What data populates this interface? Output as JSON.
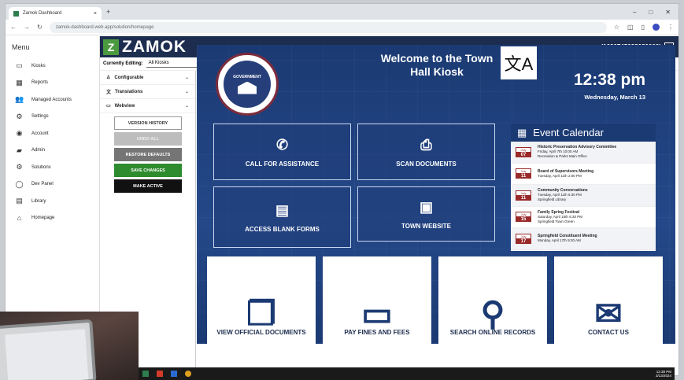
{
  "browser": {
    "tab_title": "Zamok Dashboard",
    "tab_close": "×",
    "new_tab": "+",
    "url": "zamok-dashboard.web.app/solution/homepage",
    "window_controls": [
      "–",
      "□",
      "✕"
    ]
  },
  "menu": {
    "title": "Menu",
    "items": [
      {
        "label": "Kiosks",
        "icon": "monitor-icon",
        "glyph": "▭"
      },
      {
        "label": "Reports",
        "icon": "reports-icon",
        "glyph": "▦"
      },
      {
        "label": "Managed Accounts",
        "icon": "users-icon",
        "glyph": "👥"
      },
      {
        "label": "Settings",
        "icon": "gear-icon",
        "glyph": "⚙"
      },
      {
        "label": "Account",
        "icon": "account-icon",
        "glyph": "◉"
      },
      {
        "label": "Admin",
        "icon": "briefcase-icon",
        "glyph": "▰"
      },
      {
        "label": "Solutions",
        "icon": "solutions-icon",
        "glyph": "⚙"
      },
      {
        "label": "Dev Panel",
        "icon": "dev-panel-icon",
        "glyph": "◯"
      },
      {
        "label": "Library",
        "icon": "library-icon",
        "glyph": "▤"
      },
      {
        "label": "Homepage",
        "icon": "home-icon",
        "glyph": "⌂"
      }
    ]
  },
  "header": {
    "logo_mark": "Z",
    "logo_text": "ZAMOK",
    "device_id": "(1620745088080000)",
    "exit_glyph": "→"
  },
  "editing": {
    "label": "Currently Editing:",
    "value": "All Kiosks",
    "chevron": "⌄"
  },
  "config": {
    "sections": [
      {
        "label": "Configurable",
        "icon": "configurable-icon",
        "glyph": "♙"
      },
      {
        "label": "Translations",
        "icon": "translate-icon",
        "glyph": "文"
      },
      {
        "label": "Webview",
        "icon": "webview-icon",
        "glyph": "▭"
      }
    ],
    "chevron": "⌄",
    "buttons": {
      "version_history": "VERSION HISTORY",
      "undo_all": "UNDO ALL",
      "restore_defaults": "RESTORE DEFAULTS",
      "save_changes": "SAVE CHANGES",
      "make_active": "MAKE ACTIVE"
    }
  },
  "kiosk": {
    "seal_text": "GOVERNMENT",
    "welcome": "Welcome to the Town Hall Kiosk",
    "lang_glyph": "文A",
    "time": "12:38 pm",
    "date": "Wednesday, March 13",
    "tiles_small": [
      {
        "label": "CALL FOR ASSISTANCE",
        "icon": "phone-icon",
        "glyph": "✆"
      },
      {
        "label": "SCAN DOCUMENTS",
        "icon": "scanner-icon",
        "glyph": "⎙"
      },
      {
        "label": "ACCESS BLANK FORMS",
        "icon": "forms-icon",
        "glyph": "▤"
      },
      {
        "label": "TOWN WEBSITE",
        "icon": "website-icon",
        "glyph": "▣"
      }
    ],
    "calendar": {
      "title": "Event Calendar",
      "icon_glyph": "▦",
      "events": [
        {
          "month": "July",
          "day": "07",
          "title": "Historic Preservation Advisory Committee",
          "time": "Friday, April 7th 10:00 AM",
          "place": "Recreation & Parks Main Office"
        },
        {
          "month": "July",
          "day": "11",
          "title": "Board of Supervisors Meeting",
          "time": "Tuesday, April 11th 2:00 PM",
          "place": ""
        },
        {
          "month": "July",
          "day": "11",
          "title": "Community Conversations",
          "time": "Tuesday, April 11th 6:30 PM",
          "place": "Springfield Library"
        },
        {
          "month": "July",
          "day": "15",
          "title": "Family Spring Festival",
          "time": "Saturday, April 15th 6:30 PM",
          "place": "Springfield Town Green"
        },
        {
          "month": "July",
          "day": "17",
          "title": "Springfield Constituent Meeting",
          "time": "Monday, April 17th 9:30 AM",
          "place": ""
        }
      ]
    },
    "tiles_large": [
      {
        "label": "VIEW OFFICIAL DOCUMENTS",
        "icon": "documents-icon",
        "glyph": "❐"
      },
      {
        "label": "PAY FINES AND FEES",
        "icon": "credit-card-icon",
        "glyph": "▭"
      },
      {
        "label": "SEARCH ONLINE RECORDS",
        "icon": "search-icon",
        "glyph": "⚲"
      },
      {
        "label": "CONTACT US",
        "icon": "envelope-icon",
        "glyph": "✉"
      }
    ]
  },
  "taskbar": {
    "time": "12:38 PM",
    "date": "3/13/2024"
  },
  "colors": {
    "navy": "#1d2d4f",
    "kiosk_blue": "#1b3a73",
    "brand_green": "#4c9a3f",
    "save_green": "#2e8b2e",
    "calendar_red": "#9a2a2a"
  }
}
